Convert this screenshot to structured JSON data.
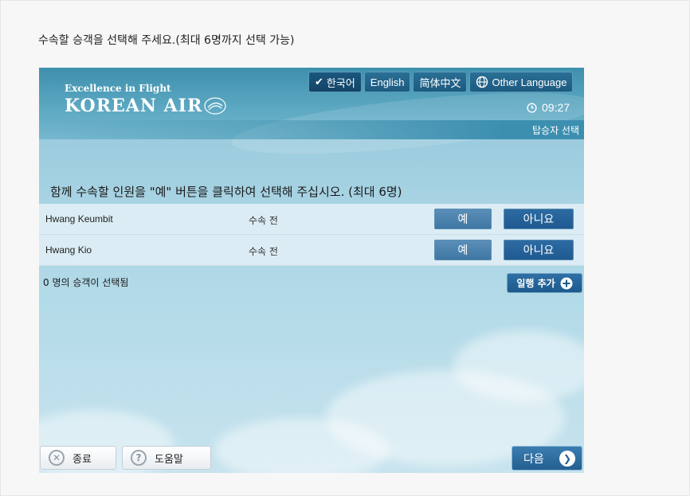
{
  "instruction": "수속할 승객을 선택해 주세요.(최대 6명까지 선택 가능)",
  "header": {
    "tagline": "Excellence in Flight",
    "wordmark": "KOREAN AIR",
    "languages": [
      {
        "label": "한국어",
        "selected": true
      },
      {
        "label": "English",
        "selected": false
      },
      {
        "label": "简体中文",
        "selected": false
      },
      {
        "label": "Other Language",
        "selected": false
      }
    ],
    "clock": "09:27",
    "step": "탑승자 선택"
  },
  "prompt": "함께 수속할 인원을 \"예\" 버튼을 클릭하여 선택해 주십시오. (최대 6명)",
  "passengers": [
    {
      "name": "Hwang Keumbit",
      "status": "수속 전",
      "yes": "예",
      "no": "아니요"
    },
    {
      "name": "Hwang Kio",
      "status": "수속 전",
      "yes": "예",
      "no": "아니요"
    }
  ],
  "selected_count": "0 명의 승객이 선택됨",
  "add_companion": "일행 추가",
  "footer": {
    "exit": "종료",
    "help": "도움말",
    "next": "다음"
  },
  "colors": {
    "header_blue": "#3e90ad",
    "button_blue": "#1f5a90",
    "sky": "#b4dbe8"
  }
}
